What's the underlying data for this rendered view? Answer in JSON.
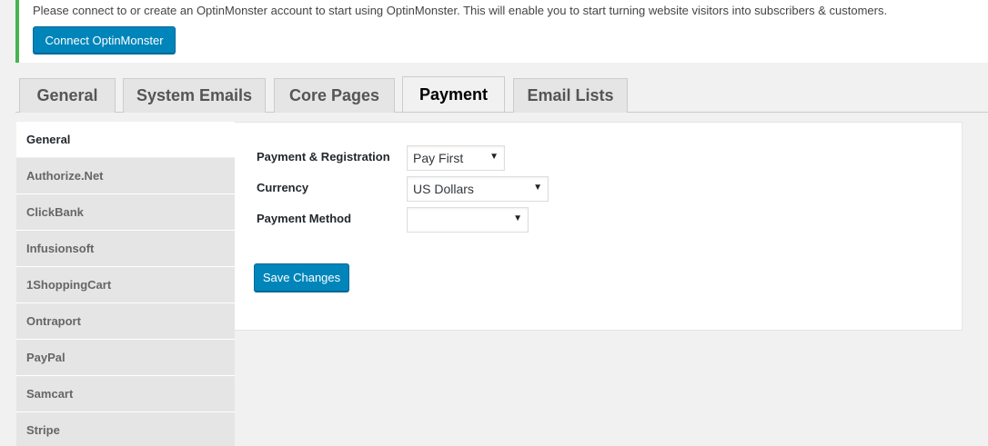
{
  "notice": {
    "text": "Please connect to or create an OptinMonster account to start using OptinMonster. This will enable you to start turning website visitors into subscribers & customers.",
    "button_label": "Connect OptinMonster"
  },
  "tabs": [
    {
      "label": "General"
    },
    {
      "label": "System Emails"
    },
    {
      "label": "Core Pages"
    },
    {
      "label": "Payment",
      "active": true
    },
    {
      "label": "Email Lists"
    }
  ],
  "sidebar": {
    "items": [
      {
        "label": "General",
        "active": true
      },
      {
        "label": "Authorize.Net"
      },
      {
        "label": "ClickBank"
      },
      {
        "label": "Infusionsoft"
      },
      {
        "label": "1ShoppingCart"
      },
      {
        "label": "Ontraport"
      },
      {
        "label": "PayPal"
      },
      {
        "label": "Samcart"
      },
      {
        "label": "Stripe"
      }
    ]
  },
  "form": {
    "payment_registration": {
      "label": "Payment & Registration",
      "value": "Pay First"
    },
    "currency": {
      "label": "Currency",
      "value": "US Dollars"
    },
    "payment_method": {
      "label": "Payment Method",
      "value": ""
    },
    "save_label": "Save Changes"
  },
  "icons": {
    "dropdown": "dropdown-arrow-icon"
  },
  "colors": {
    "accent": "#0085ba",
    "notice_border": "#46b450"
  }
}
